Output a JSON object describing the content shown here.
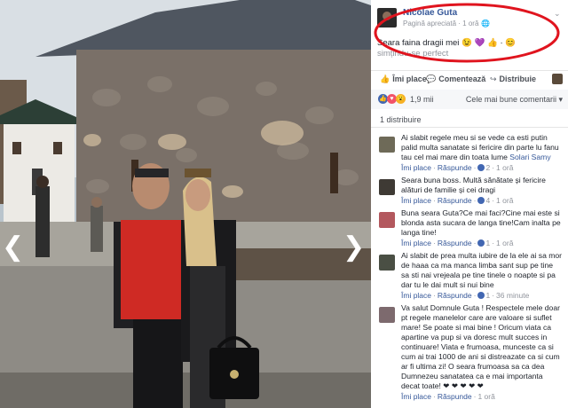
{
  "photo": {
    "prev_arrow": "❮",
    "next_arrow": "❯"
  },
  "post": {
    "author": "Nicolae Guta",
    "meta": "Pagină apreciată · 1 oră",
    "text_before": "Seara faina dragii mei",
    "emoji_seq": "😉 💜 👍 ·",
    "feeling": "simțindu-se",
    "feeling_cont": "perfect"
  },
  "actions": {
    "like": "Îmi place",
    "comment": "Comentează",
    "share": "Distribuie"
  },
  "reactions": {
    "count": "1,9 mii",
    "sort": "Cele mai bune comentarii ▾",
    "shares": "1 distribuire"
  },
  "comments": [
    {
      "author": "",
      "text": "Ai slabit regele meu si se vede ca esti putin palid multa sanatate si fericire din parte lu fanu tau cel mai mare din toata lume",
      "tag": "Solari Samy",
      "like": "Îmi place",
      "reply": "Răspunde",
      "count": "2",
      "time": "1 oră"
    },
    {
      "author": "",
      "text": "Seara buna boss. Multă sănătate și fericire alături de familie și cei dragi",
      "tag": "",
      "like": "Îmi place",
      "reply": "Răspunde",
      "count": "4",
      "time": "1 oră"
    },
    {
      "author": "",
      "text": "Buna seara Guta?Ce mai faci?Cine mai este si blonda asta sucara de langa tine!Cam inalta pe langa tine!",
      "tag": "",
      "like": "Îmi place",
      "reply": "Răspunde",
      "count": "1",
      "time": "1 oră"
    },
    {
      "author": "",
      "text": "Ai slabit de prea multa iubire de la ele ai sa mor de haaa ca ma manca limba sant sup pe tine sa sti nai vrejeala pe tine tinele o noapte si pa dar tu le dai mult si nui bine",
      "tag": "",
      "like": "Îmi place",
      "reply": "Răspunde",
      "count": "1",
      "time": "36 minute"
    },
    {
      "author": "",
      "text": "Va salut Domnule Guta ! Respectele mele doar pt regele manelelor care are valoare si suflet mare! Se poate si mai bine ! Oricum viata ca apartine va pup si va doresc mult succes in continuare! Viata e frumoasa, munceste ca si cum ai trai 1000 de ani si distreazate ca si cum ar fi ultima zi! O seara frumoasa sa ca dea Dumnezeu sanatatea ca e mai importanta decat toate! ❤ ❤ ❤ ❤ ❤",
      "tag": "",
      "like": "Îmi place",
      "reply": "Răspunde",
      "count": "",
      "time": "1 oră"
    }
  ],
  "colors": {
    "link": "#365899",
    "muted": "#90949c",
    "circle": "#e0141e",
    "like_blue": "#4267b2",
    "love_red": "#f25268",
    "wow_yellow": "#f7b125"
  },
  "icons": [
    "chevron-left-icon",
    "chevron-right-icon",
    "globe-icon",
    "like-icon",
    "comment-icon",
    "share-icon",
    "love-reaction-icon",
    "wow-reaction-icon"
  ]
}
